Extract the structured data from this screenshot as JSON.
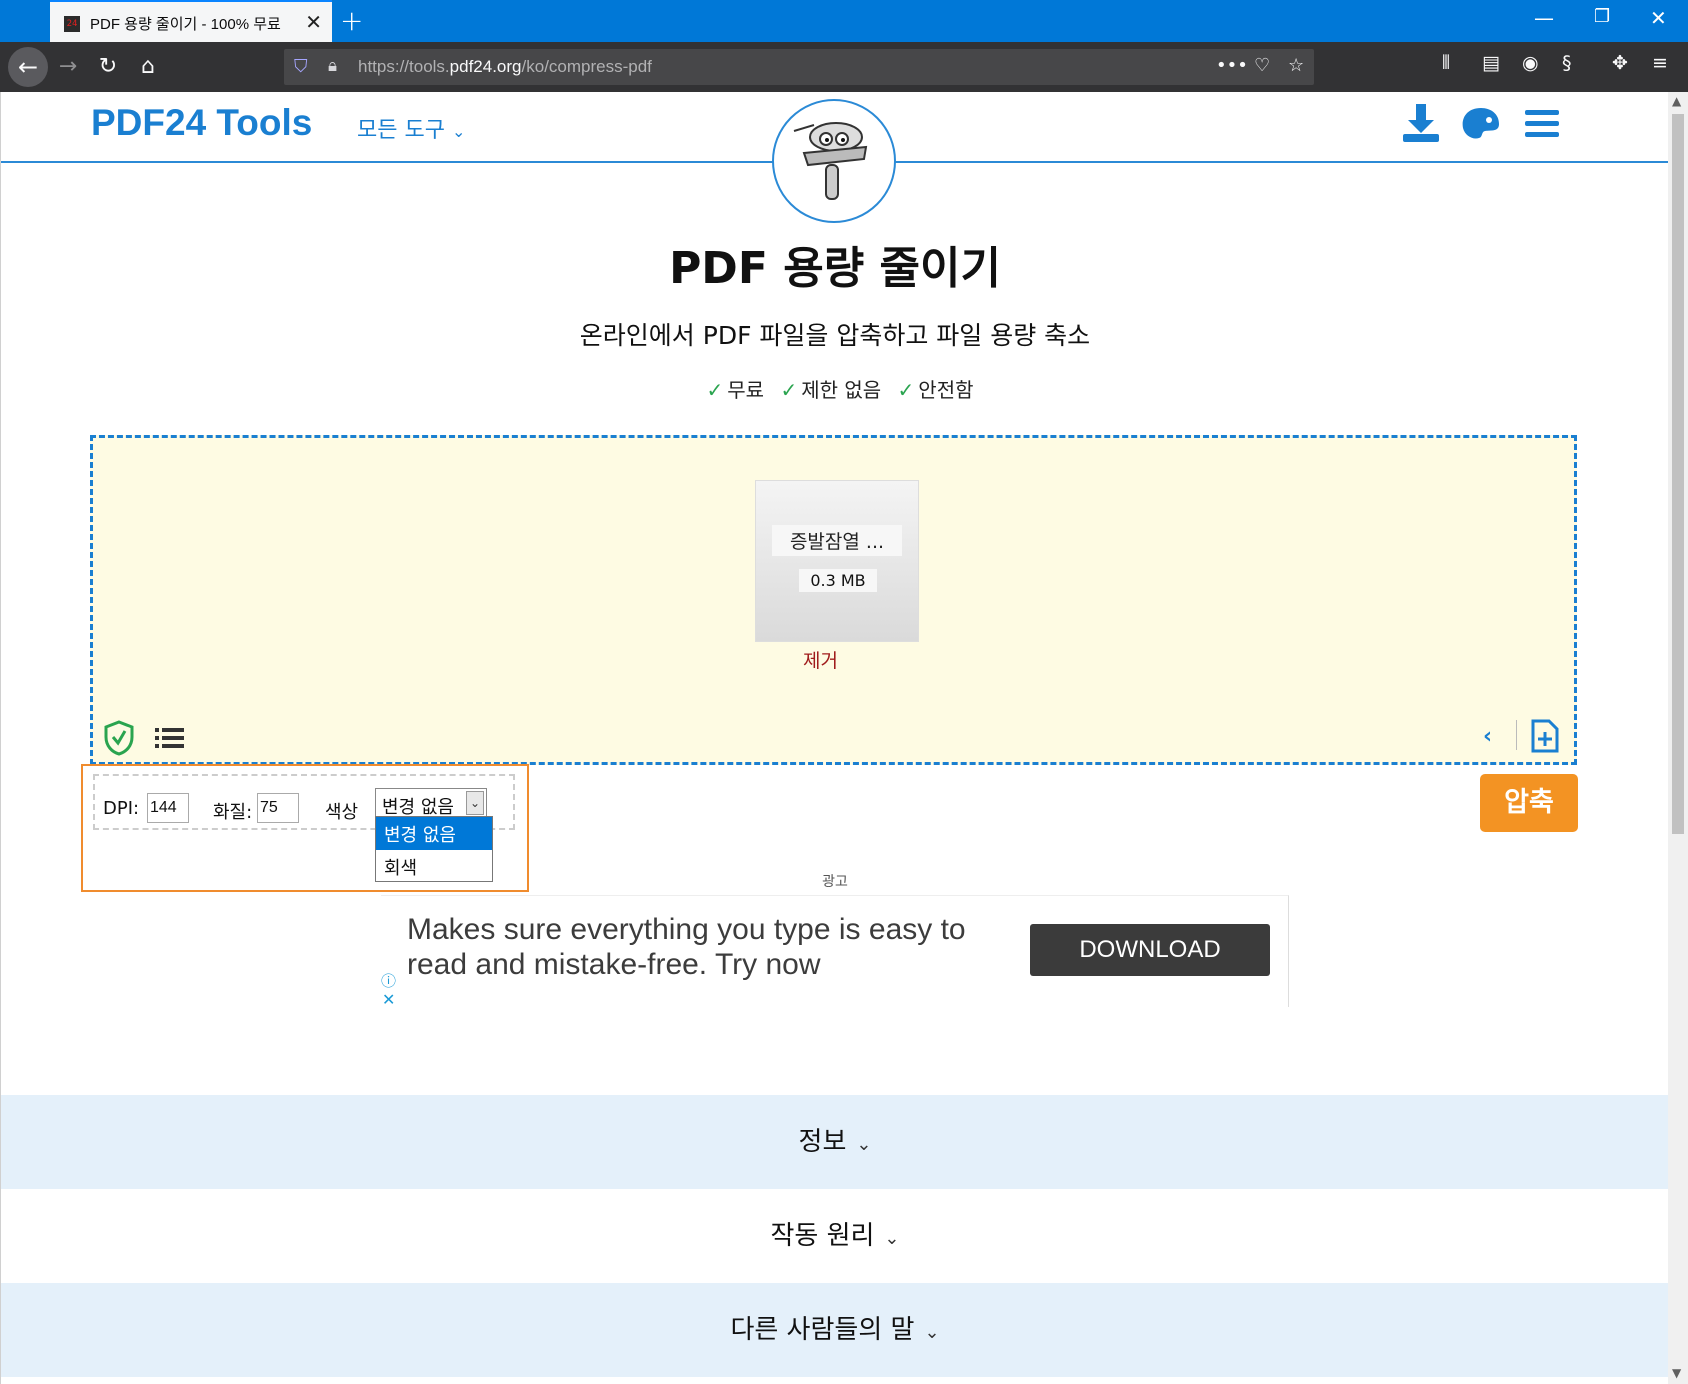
{
  "browser": {
    "tab_title": "PDF 용량 줄이기 - 100% 무료",
    "tab_favicon_text": "24",
    "url_prefix": "https://tools.",
    "url_domain": "pdf24.org",
    "url_path": "/ko/compress-pdf"
  },
  "header": {
    "brand": "PDF24 Tools",
    "all_tools_label": "모든 도구"
  },
  "page": {
    "title": "PDF 용량 줄이기",
    "subtitle": "온라인에서 PDF 파일을 압축하고 파일 용량 축소",
    "features": [
      "무료",
      "제한 없음",
      "안전함"
    ]
  },
  "file": {
    "name": "증발잠열 ...",
    "size": "0.3 MB",
    "remove_label": "제거"
  },
  "options": {
    "dpi_label": "DPI:",
    "dpi_value": "144",
    "quality_label": "화질:",
    "quality_value": "75",
    "color_label": "색상",
    "color_selected": "변경 없음",
    "color_options": [
      "변경 없음",
      "회색"
    ]
  },
  "compress_label": "압축",
  "ad": {
    "label": "광고",
    "text": "Makes sure everything you type is easy to read and mistake-free. Try now",
    "button": "DOWNLOAD"
  },
  "sections": [
    "정보",
    "작동 원리",
    "다른 사람들의 말"
  ],
  "colors": {
    "accent": "#1a7fd1",
    "compress": "#f39323",
    "dropzone_bg": "#fefbe3",
    "section_bg": "#e4f0fa",
    "remove": "#a01c1c"
  }
}
